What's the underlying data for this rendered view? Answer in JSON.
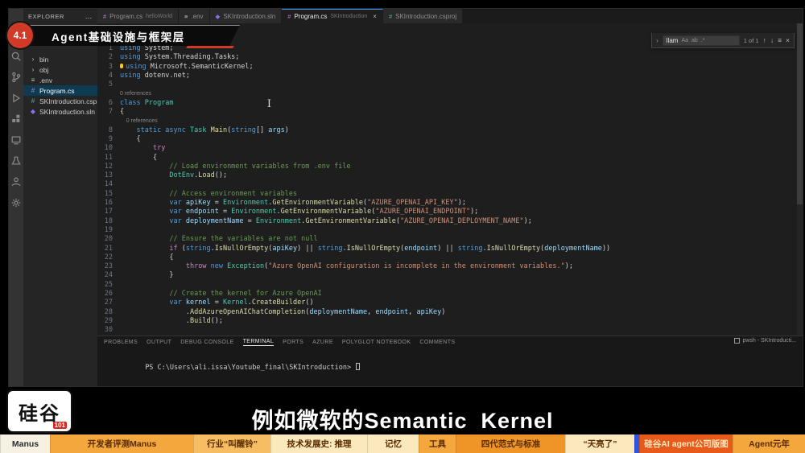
{
  "banner": {
    "badge": "4.1",
    "title": "Agent基础设施与框架层"
  },
  "caption": "例如微软的Semantic  Kernel",
  "logo": {
    "text": "硅谷",
    "badge": "101"
  },
  "glyphs": {
    "ibeam": "I"
  },
  "vscode": {
    "activity_icons": [
      {
        "name": "search-icon",
        "shape": "search"
      },
      {
        "name": "source-control-icon",
        "shape": "scm"
      },
      {
        "name": "run-debug-icon",
        "shape": "debug"
      },
      {
        "name": "extensions-icon",
        "shape": "extensions"
      },
      {
        "name": "remote-explorer-icon",
        "shape": "remote"
      },
      {
        "name": "test-explorer-icon",
        "shape": "flask"
      },
      {
        "name": "account-icon",
        "shape": "account"
      },
      {
        "name": "settings-gear-icon",
        "shape": "gear"
      }
    ],
    "explorer": {
      "header": "EXPLORER",
      "more": "…",
      "items": [
        {
          "label": "bin",
          "icon": "folder"
        },
        {
          "label": "obj",
          "icon": "folder"
        },
        {
          "label": ".env",
          "icon": "gear"
        },
        {
          "label": "Program.cs",
          "icon": "csharp",
          "selected": true
        },
        {
          "label": "SKIntroduction.csproj",
          "icon": "proj"
        },
        {
          "label": "SKIntroduction.sln",
          "icon": "sln"
        }
      ]
    },
    "tabs": [
      {
        "title": "Program.cs",
        "detail": "helloWorld",
        "icon": "csharp",
        "active": false,
        "close": false
      },
      {
        "title": ".env",
        "detail": "",
        "icon": "gear",
        "active": false,
        "close": false
      },
      {
        "title": "SKIntroduction.sln",
        "detail": "",
        "icon": "sln",
        "active": false,
        "close": false
      },
      {
        "title": "Program.cs",
        "detail": "SKIntroduction",
        "icon": "csharp",
        "active": true,
        "close": true
      },
      {
        "title": "SKIntroduction.csproj",
        "detail": "",
        "icon": "proj",
        "active": false,
        "close": false
      }
    ],
    "find": {
      "chevron": "›",
      "query": "llam",
      "toggles": [
        "Aa",
        "ab",
        ".*"
      ],
      "matches": "1 of 1",
      "prev": "↑",
      "next": "↓",
      "selection": "≡",
      "close": "×"
    },
    "editor": {
      "lines": [
        {
          "n": "1",
          "t": [
            [
              "kw",
              "using "
            ],
            [
              "pl",
              "System;"
            ]
          ]
        },
        {
          "n": "2",
          "t": [
            [
              "kw",
              "using "
            ],
            [
              "pl",
              "System.Threading.Tasks;"
            ]
          ]
        },
        {
          "n": "3",
          "b": 1,
          "t": [
            [
              "kw",
              "using "
            ],
            [
              "pl",
              "Microsoft.SemanticKernel;"
            ]
          ]
        },
        {
          "n": "4",
          "t": [
            [
              "kw",
              "using "
            ],
            [
              "pl",
              "dotenv.net;"
            ]
          ]
        },
        {
          "n": "5",
          "t": []
        },
        {
          "n": "6",
          "lens": "0 references",
          "t": [
            [
              "kw",
              "class "
            ],
            [
              "ty",
              "Program"
            ]
          ]
        },
        {
          "n": "7",
          "t": [
            [
              "pl",
              "{"
            ]
          ]
        },
        {
          "n": "8",
          "lens": "    0 references",
          "t": [
            [
              "pl",
              "    "
            ],
            [
              "kw",
              "static async "
            ],
            [
              "ty",
              "Task "
            ],
            [
              "fn",
              "Main"
            ],
            [
              "pl",
              "("
            ],
            [
              "kw",
              "string"
            ],
            [
              "pl",
              "[] "
            ],
            [
              "vr",
              "args"
            ],
            [
              "pl",
              ")"
            ]
          ]
        },
        {
          "n": "9",
          "t": [
            [
              "pl",
              "    {"
            ]
          ]
        },
        {
          "n": "10",
          "t": [
            [
              "pl",
              "        "
            ],
            [
              "ct",
              "try"
            ]
          ]
        },
        {
          "n": "11",
          "t": [
            [
              "pl",
              "        {"
            ]
          ]
        },
        {
          "n": "12",
          "t": [
            [
              "pl",
              "            "
            ],
            [
              "cm",
              "// Load environment variables from .env file"
            ]
          ]
        },
        {
          "n": "13",
          "t": [
            [
              "pl",
              "            "
            ],
            [
              "ty",
              "DotEnv"
            ],
            [
              "pl",
              "."
            ],
            [
              "fn",
              "Load"
            ],
            [
              "pl",
              "();"
            ]
          ]
        },
        {
          "n": "14",
          "t": []
        },
        {
          "n": "15",
          "t": [
            [
              "pl",
              "            "
            ],
            [
              "cm",
              "// Access environment variables"
            ]
          ]
        },
        {
          "n": "16",
          "t": [
            [
              "pl",
              "            "
            ],
            [
              "kw",
              "var "
            ],
            [
              "vr",
              "apiKey"
            ],
            [
              "pl",
              " = "
            ],
            [
              "ty",
              "Environment"
            ],
            [
              "pl",
              "."
            ],
            [
              "fn",
              "GetEnvironmentVariable"
            ],
            [
              "pl",
              "("
            ],
            [
              "st",
              "\"AZURE_OPENAI_API_KEY\""
            ],
            [
              "pl",
              ");"
            ]
          ]
        },
        {
          "n": "17",
          "t": [
            [
              "pl",
              "            "
            ],
            [
              "kw",
              "var "
            ],
            [
              "vr",
              "endpoint"
            ],
            [
              "pl",
              " = "
            ],
            [
              "ty",
              "Environment"
            ],
            [
              "pl",
              "."
            ],
            [
              "fn",
              "GetEnvironmentVariable"
            ],
            [
              "pl",
              "("
            ],
            [
              "st",
              "\"AZURE_OPENAI_ENDPOINT\""
            ],
            [
              "pl",
              ");"
            ]
          ]
        },
        {
          "n": "18",
          "t": [
            [
              "pl",
              "            "
            ],
            [
              "kw",
              "var "
            ],
            [
              "vr",
              "deploymentName"
            ],
            [
              "pl",
              " = "
            ],
            [
              "ty",
              "Environment"
            ],
            [
              "pl",
              "."
            ],
            [
              "fn",
              "GetEnvironmentVariable"
            ],
            [
              "pl",
              "("
            ],
            [
              "st",
              "\"AZURE_OPENAI_DEPLOYMENT_NAME\""
            ],
            [
              "pl",
              ");"
            ]
          ]
        },
        {
          "n": "19",
          "t": []
        },
        {
          "n": "20",
          "t": [
            [
              "pl",
              "            "
            ],
            [
              "cm",
              "// Ensure the variables are not null"
            ]
          ]
        },
        {
          "n": "21",
          "t": [
            [
              "pl",
              "            "
            ],
            [
              "ct",
              "if"
            ],
            [
              "pl",
              " ("
            ],
            [
              "kw",
              "string"
            ],
            [
              "pl",
              "."
            ],
            [
              "fn",
              "IsNullOrEmpty"
            ],
            [
              "pl",
              "("
            ],
            [
              "vr",
              "apiKey"
            ],
            [
              "pl",
              ") || "
            ],
            [
              "kw",
              "string"
            ],
            [
              "pl",
              "."
            ],
            [
              "fn",
              "IsNullOrEmpty"
            ],
            [
              "pl",
              "("
            ],
            [
              "vr",
              "endpoint"
            ],
            [
              "pl",
              ") || "
            ],
            [
              "kw",
              "string"
            ],
            [
              "pl",
              "."
            ],
            [
              "fn",
              "IsNullOrEmpty"
            ],
            [
              "pl",
              "("
            ],
            [
              "vr",
              "deploymentName"
            ],
            [
              "pl",
              "))"
            ]
          ]
        },
        {
          "n": "22",
          "t": [
            [
              "pl",
              "            {"
            ]
          ]
        },
        {
          "n": "23",
          "t": [
            [
              "pl",
              "                "
            ],
            [
              "ct",
              "throw "
            ],
            [
              "kw",
              "new "
            ],
            [
              "ty",
              "Exception"
            ],
            [
              "pl",
              "("
            ],
            [
              "st",
              "\"Azure OpenAI configuration is incomplete in the environment variables.\""
            ],
            [
              "pl",
              ");"
            ]
          ]
        },
        {
          "n": "24",
          "t": [
            [
              "pl",
              "            }"
            ]
          ]
        },
        {
          "n": "25",
          "t": []
        },
        {
          "n": "26",
          "t": [
            [
              "pl",
              "            "
            ],
            [
              "cm",
              "// Create the kernel for Azure OpenAI"
            ]
          ]
        },
        {
          "n": "27",
          "t": [
            [
              "pl",
              "            "
            ],
            [
              "kw",
              "var "
            ],
            [
              "vr",
              "kernel"
            ],
            [
              "pl",
              " = "
            ],
            [
              "ty",
              "Kernel"
            ],
            [
              "pl",
              "."
            ],
            [
              "fn",
              "CreateBuilder"
            ],
            [
              "pl",
              "()"
            ]
          ]
        },
        {
          "n": "28",
          "t": [
            [
              "pl",
              "                ."
            ],
            [
              "fn",
              "AddAzureOpenAIChatCompletion"
            ],
            [
              "pl",
              "("
            ],
            [
              "vr",
              "deploymentName"
            ],
            [
              "pl",
              ", "
            ],
            [
              "vr",
              "endpoint"
            ],
            [
              "pl",
              ", "
            ],
            [
              "vr",
              "apiKey"
            ],
            [
              "pl",
              ")"
            ]
          ]
        },
        {
          "n": "29",
          "t": [
            [
              "pl",
              "                ."
            ],
            [
              "fn",
              "Build"
            ],
            [
              "pl",
              "();"
            ]
          ]
        },
        {
          "n": "30",
          "t": []
        }
      ]
    },
    "panel": {
      "tabs": [
        {
          "label": "PROBLEMS"
        },
        {
          "label": "OUTPUT"
        },
        {
          "label": "DEBUG CONSOLE"
        },
        {
          "label": "TERMINAL",
          "active": true
        },
        {
          "label": "PORTS"
        },
        {
          "label": "AZURE"
        },
        {
          "label": "POLYGLOT NOTEBOOK"
        },
        {
          "label": "COMMENTS"
        }
      ],
      "prompt": "PS C:\\Users\\ali.issa\\Youtube_final\\SKIntroduction> ",
      "shell_label": "pwsh - SKIntroducti..."
    }
  },
  "bottom_bar": [
    {
      "label": "Manus",
      "bg": "#f6f1e3",
      "fg": "#2e2e2e",
      "w": 6.2
    },
    {
      "label": "开发者评测Manus",
      "bg": "#f3a73d",
      "fg": "#5a2c00",
      "w": 17.8
    },
    {
      "label": "行业“叫醒铃”",
      "bg": "#f6bd62",
      "fg": "#5a2c00",
      "w": 9.6
    },
    {
      "label": "技术发展史: 推理",
      "bg": "#fbe9bd",
      "fg": "#5a2c00",
      "w": 12.0
    },
    {
      "label": "记忆",
      "bg": "#fbe9bd",
      "fg": "#5a2c00",
      "w": 6.4
    },
    {
      "label": "工具",
      "bg": "#f3a73d",
      "fg": "#5a2c00",
      "w": 4.6
    },
    {
      "label": "四代范式与标准",
      "bg": "#ef9427",
      "fg": "#5a2c00",
      "w": 13.6
    },
    {
      "label": "“天亮了”",
      "bg": "#fbe9bd",
      "fg": "#5a2c00",
      "w": 8.6
    },
    {
      "label": "",
      "bg": "#2f55e8",
      "fg": "#ffffff",
      "w": 0.6
    },
    {
      "label": "硅谷AI agent公司版图",
      "bg": "#e85a1a",
      "fg": "#ffe9c2",
      "w": 11.6
    },
    {
      "label": "Agent元年",
      "bg": "#f3a73d",
      "fg": "#5a2c00",
      "w": 9.0
    }
  ]
}
